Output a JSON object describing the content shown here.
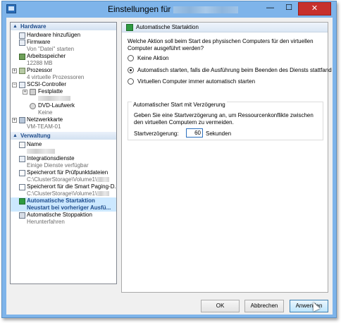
{
  "window": {
    "title": "Einstellungen für",
    "minimize_glyph": "—",
    "maximize_glyph": "☐",
    "close_glyph": "✕"
  },
  "tree": {
    "hardware_header": "Hardware",
    "items": {
      "add_hardware": "Hardware hinzufügen",
      "firmware": "Firmware",
      "firmware_sub": "Von \"Datei\" starten",
      "memory": "Arbeitsspeicher",
      "memory_sub": "12288 MB",
      "processor": "Prozessor",
      "processor_sub": "4 virtuelle Prozessoren",
      "scsi": "SCSI-Controller",
      "hdd": "Festplatte",
      "dvd": "DVD-Laufwerk",
      "dvd_sub": "Keine",
      "nic": "Netzwerkkarte",
      "nic_sub": "VM-TEAM-01"
    },
    "management_header": "Verwaltung",
    "mgmt": {
      "name": "Name",
      "integration": "Integrationsdienste",
      "integration_sub": "Einige Dienste verfügbar",
      "checkpoint": "Speicherort für Prüfpunktdateien",
      "checkpoint_sub": "C:\\ClusterStorage\\Volume1\\",
      "paging": "Speicherort für die Smart Paging-D...",
      "paging_sub": "C:\\ClusterStorage\\Volume1\\",
      "autostart": "Automatische Startaktion",
      "autostart_sub": "Neustart bei vorheriger Ausfü...",
      "autostop": "Automatische Stoppaktion",
      "autostop_sub": "Herunterfahren"
    }
  },
  "panel": {
    "title": "Automatische Startaktion",
    "question": "Welche Aktion soll beim Start des physischen Computers für den virtuellen Computer ausgeführt werden?",
    "options": [
      {
        "label": "Keine Aktion",
        "selected": false
      },
      {
        "label": "Automatisch starten, falls die Ausführung beim Beenden des Diensts stattfand",
        "selected": true
      },
      {
        "label": "Virtuellen Computer immer automatisch starten",
        "selected": false
      }
    ],
    "group_title": "Automatischer Start mit Verzögerung",
    "group_desc": "Geben Sie eine Startverzögerung an, um Ressourcenkonflikte zwischen den virtuellen Computern zu vermeiden.",
    "delay_label": "Startverzögerung:",
    "delay_value": "60",
    "delay_unit": "Sekunden"
  },
  "buttons": {
    "ok": "OK",
    "cancel": "Abbrechen",
    "apply": "Anwenden"
  }
}
